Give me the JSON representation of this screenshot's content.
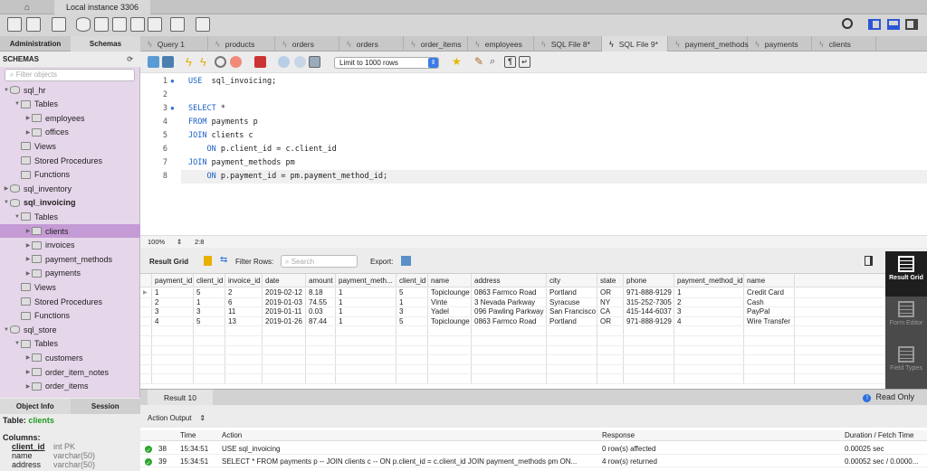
{
  "window": {
    "instance_tab": "Local instance 3306"
  },
  "left_tabs": [
    "Administration",
    "Schemas"
  ],
  "query_tabs": [
    {
      "label": "Query 1"
    },
    {
      "label": "products"
    },
    {
      "label": "orders"
    },
    {
      "label": "orders"
    },
    {
      "label": "order_items"
    },
    {
      "label": "employees"
    },
    {
      "label": "SQL File 8*"
    },
    {
      "label": "SQL File 9*",
      "active": true
    },
    {
      "label": "payment_methods"
    },
    {
      "label": "payments"
    },
    {
      "label": "clients"
    }
  ],
  "schemas": {
    "title": "SCHEMAS",
    "filter_placeholder": "Filter objects",
    "tree": [
      {
        "label": "sql_hr",
        "level": 0,
        "type": "db",
        "open": true
      },
      {
        "label": "Tables",
        "level": 1,
        "type": "folder",
        "open": true
      },
      {
        "label": "employees",
        "level": 2,
        "type": "table"
      },
      {
        "label": "offices",
        "level": 2,
        "type": "table"
      },
      {
        "label": "Views",
        "level": 1,
        "type": "folder"
      },
      {
        "label": "Stored Procedures",
        "level": 1,
        "type": "folder"
      },
      {
        "label": "Functions",
        "level": 1,
        "type": "folder"
      },
      {
        "label": "sql_inventory",
        "level": 0,
        "type": "db"
      },
      {
        "label": "sql_invoicing",
        "level": 0,
        "type": "db",
        "open": true,
        "bold": true
      },
      {
        "label": "Tables",
        "level": 1,
        "type": "folder",
        "open": true
      },
      {
        "label": "clients",
        "level": 2,
        "type": "table",
        "selected": true
      },
      {
        "label": "invoices",
        "level": 2,
        "type": "table"
      },
      {
        "label": "payment_methods",
        "level": 2,
        "type": "table"
      },
      {
        "label": "payments",
        "level": 2,
        "type": "table"
      },
      {
        "label": "Views",
        "level": 1,
        "type": "folder"
      },
      {
        "label": "Stored Procedures",
        "level": 1,
        "type": "folder"
      },
      {
        "label": "Functions",
        "level": 1,
        "type": "folder"
      },
      {
        "label": "sql_store",
        "level": 0,
        "type": "db",
        "open": true
      },
      {
        "label": "Tables",
        "level": 1,
        "type": "folder",
        "open": true
      },
      {
        "label": "customers",
        "level": 2,
        "type": "table"
      },
      {
        "label": "order_item_notes",
        "level": 2,
        "type": "table"
      },
      {
        "label": "order_items",
        "level": 2,
        "type": "table"
      }
    ]
  },
  "object_info": {
    "tabs": [
      "Object Info",
      "Session"
    ],
    "table_label": "Table:",
    "table_name": "clients",
    "columns_label": "Columns:",
    "columns": [
      {
        "name": "client_id",
        "type": "int PK"
      },
      {
        "name": "name",
        "type": "varchar(50)"
      },
      {
        "name": "address",
        "type": "varchar(50)"
      }
    ]
  },
  "editor": {
    "limit": "Limit to 1000 rows",
    "lines": [
      {
        "n": "1",
        "dot": true,
        "parts": [
          [
            "kw",
            "USE"
          ],
          [
            "",
            "  sql_invoicing;"
          ]
        ]
      },
      {
        "n": "2",
        "parts": []
      },
      {
        "n": "3",
        "dot": true,
        "parts": [
          [
            "kw",
            "SELECT"
          ],
          [
            "",
            " *"
          ]
        ]
      },
      {
        "n": "4",
        "parts": [
          [
            "kw",
            "FROM"
          ],
          [
            "",
            " payments p"
          ]
        ]
      },
      {
        "n": "5",
        "parts": [
          [
            "kw",
            "JOIN"
          ],
          [
            "",
            " clients c"
          ]
        ]
      },
      {
        "n": "6",
        "parts": [
          [
            "",
            "    "
          ],
          [
            "kw",
            "ON"
          ],
          [
            "",
            " p.client_id = c.client_id"
          ]
        ]
      },
      {
        "n": "7",
        "parts": [
          [
            "kw",
            "JOIN"
          ],
          [
            "",
            " payment_methods pm"
          ]
        ]
      },
      {
        "n": "8",
        "parts": [
          [
            "",
            "    "
          ],
          [
            "kw",
            "ON"
          ],
          [
            "",
            " p.payment_id = pm.payment_method_id;"
          ]
        ]
      }
    ],
    "zoom": "100%",
    "cursor": "2:8"
  },
  "result": {
    "label": "Result Grid",
    "filter_label": "Filter Rows:",
    "search_placeholder": "Search",
    "export_label": "Export:",
    "columns": [
      "payment_id",
      "client_id",
      "invoice_id",
      "date",
      "amount",
      "payment_meth...",
      "client_id",
      "name",
      "address",
      "city",
      "state",
      "phone",
      "payment_method_id",
      "name"
    ],
    "rows": [
      [
        "1",
        "5",
        "2",
        "2019-02-12",
        "8.18",
        "1",
        "5",
        "Topiclounge",
        "0863 Farmco Road",
        "Portland",
        "OR",
        "971-888-9129",
        "1",
        "Credit Card"
      ],
      [
        "2",
        "1",
        "6",
        "2019-01-03",
        "74.55",
        "1",
        "1",
        "Vinte",
        "3 Nevada Parkway",
        "Syracuse",
        "NY",
        "315-252-7305",
        "2",
        "Cash"
      ],
      [
        "3",
        "3",
        "11",
        "2019-01-11",
        "0.03",
        "1",
        "3",
        "Yadel",
        "096 Pawling Parkway",
        "San Francisco",
        "CA",
        "415-144-6037",
        "3",
        "PayPal"
      ],
      [
        "4",
        "5",
        "13",
        "2019-01-26",
        "87.44",
        "1",
        "5",
        "Topiclounge",
        "0863 Farmco Road",
        "Portland",
        "OR",
        "971-888-9129",
        "4",
        "Wire Transfer"
      ]
    ],
    "side_buttons": [
      "Result Grid",
      "Form Editor",
      "Field Types"
    ],
    "tab": "Result 10",
    "read_only": "Read Only"
  },
  "output": {
    "selector": "Action Output",
    "headers": [
      "Time",
      "Action",
      "Response",
      "Duration / Fetch Time"
    ],
    "rows": [
      {
        "n": "38",
        "time": "15:34:51",
        "action": "USE sql_invoicing",
        "response": "0 row(s) affected",
        "duration": "0.00025 sec"
      },
      {
        "n": "39",
        "time": "15:34:51",
        "action": "SELECT * FROM payments p -- JOIN clients c  -- ON p.client_id = c.client_id JOIN payment_methods pm  ON...",
        "response": "4 row(s) returned",
        "duration": "0.00052 sec / 0.0000..."
      }
    ]
  },
  "colors": {
    "sidebar": "#e6d6ea",
    "selected": "#c59bd6",
    "keyword": "#1a60c8",
    "accent": "#2a6fe0"
  }
}
